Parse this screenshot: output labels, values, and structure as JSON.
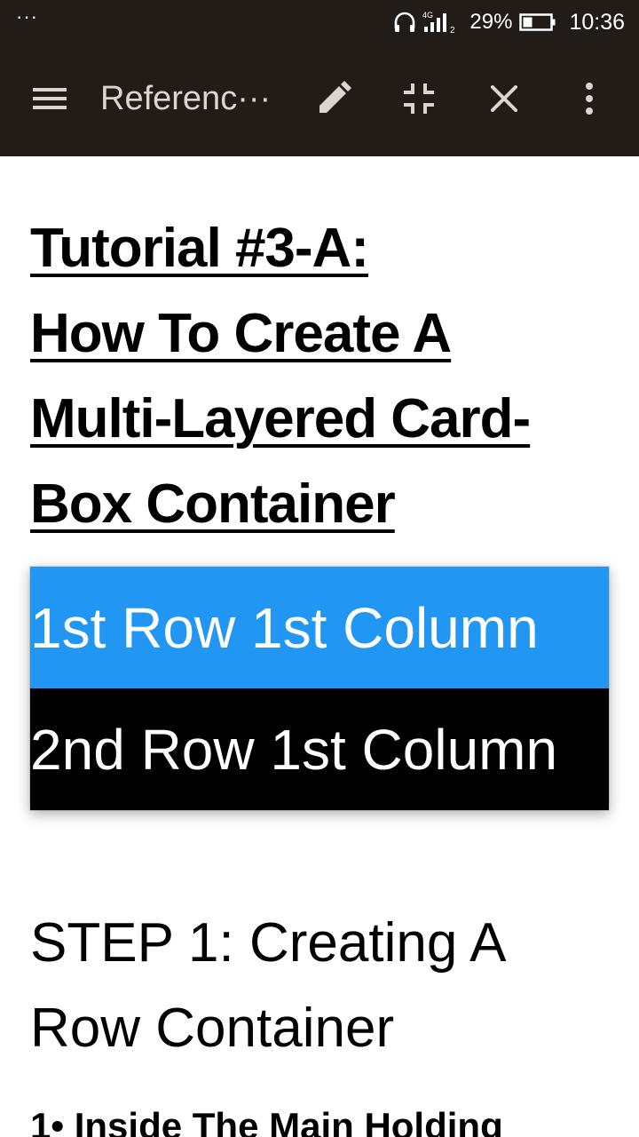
{
  "status_bar": {
    "notification_dots": "···",
    "battery_percent": "29%",
    "time": "10:36",
    "network_label": "4G",
    "icons": [
      "headphones-icon",
      "signal-icon",
      "battery-icon"
    ]
  },
  "app_bar": {
    "title": "Referenc···",
    "icons": [
      "menu-icon",
      "edit-icon",
      "collapse-icon",
      "close-icon",
      "more-vert-icon"
    ]
  },
  "article": {
    "title_lines": [
      "Tutorial #3-A:",
      "How To Create A",
      "Multi-Layered Card-",
      "Box Container"
    ],
    "card_rows": [
      {
        "label": "1st Row 1st Column",
        "bg": "#2196f3"
      },
      {
        "label": "2nd Row 1st Column",
        "bg": "#000000"
      }
    ],
    "step_heading": "STEP 1: Creating A Row Container",
    "sub_item": "1• Inside The Main Holding"
  },
  "colors": {
    "bar_bg": "#221c19",
    "title_text": "#dcd4d0",
    "accent_blue": "#2196f3"
  }
}
